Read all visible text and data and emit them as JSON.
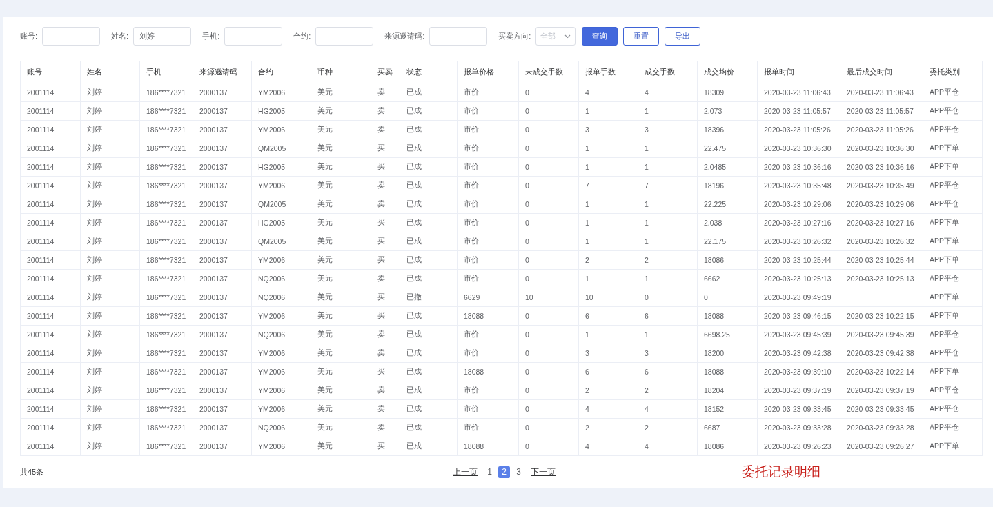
{
  "filters": [
    {
      "label": "账号:"
    },
    {
      "label": "姓名:",
      "value": "刘婷"
    },
    {
      "label": "手机:"
    },
    {
      "label": "合约:"
    },
    {
      "label": "来源邀请码:"
    }
  ],
  "direction": {
    "label": "买卖方向:",
    "placeholder": "全部"
  },
  "buttons": [
    {
      "label": "查询",
      "kind": "primary"
    },
    {
      "label": "重置",
      "kind": "outline"
    },
    {
      "label": "导出",
      "kind": "outline"
    }
  ],
  "table": {
    "columns": [
      "账号",
      "姓名",
      "手机",
      "来源邀请码",
      "合约",
      "币种",
      "买卖",
      "状态",
      "报单价格",
      "未成交手数",
      "报单手数",
      "成交手数",
      "成交均价",
      "报单时间",
      "最后成交时间",
      "委托类别"
    ],
    "rows": [
      [
        "2001114",
        "刘婷",
        "186****7321",
        "2000137",
        "YM2006",
        "美元",
        "卖",
        "已成",
        "市价",
        "0",
        "4",
        "4",
        "18309",
        "2020-03-23 11:06:43",
        "2020-03-23 11:06:43",
        "APP平仓"
      ],
      [
        "2001114",
        "刘婷",
        "186****7321",
        "2000137",
        "HG2005",
        "美元",
        "卖",
        "已成",
        "市价",
        "0",
        "1",
        "1",
        "2.073",
        "2020-03-23 11:05:57",
        "2020-03-23 11:05:57",
        "APP平仓"
      ],
      [
        "2001114",
        "刘婷",
        "186****7321",
        "2000137",
        "YM2006",
        "美元",
        "卖",
        "已成",
        "市价",
        "0",
        "3",
        "3",
        "18396",
        "2020-03-23 11:05:26",
        "2020-03-23 11:05:26",
        "APP平仓"
      ],
      [
        "2001114",
        "刘婷",
        "186****7321",
        "2000137",
        "QM2005",
        "美元",
        "买",
        "已成",
        "市价",
        "0",
        "1",
        "1",
        "22.475",
        "2020-03-23 10:36:30",
        "2020-03-23 10:36:30",
        "APP下单"
      ],
      [
        "2001114",
        "刘婷",
        "186****7321",
        "2000137",
        "HG2005",
        "美元",
        "买",
        "已成",
        "市价",
        "0",
        "1",
        "1",
        "2.0485",
        "2020-03-23 10:36:16",
        "2020-03-23 10:36:16",
        "APP下单"
      ],
      [
        "2001114",
        "刘婷",
        "186****7321",
        "2000137",
        "YM2006",
        "美元",
        "卖",
        "已成",
        "市价",
        "0",
        "7",
        "7",
        "18196",
        "2020-03-23 10:35:48",
        "2020-03-23 10:35:49",
        "APP平仓"
      ],
      [
        "2001114",
        "刘婷",
        "186****7321",
        "2000137",
        "QM2005",
        "美元",
        "卖",
        "已成",
        "市价",
        "0",
        "1",
        "1",
        "22.225",
        "2020-03-23 10:29:06",
        "2020-03-23 10:29:06",
        "APP平仓"
      ],
      [
        "2001114",
        "刘婷",
        "186****7321",
        "2000137",
        "HG2005",
        "美元",
        "买",
        "已成",
        "市价",
        "0",
        "1",
        "1",
        "2.038",
        "2020-03-23 10:27:16",
        "2020-03-23 10:27:16",
        "APP下单"
      ],
      [
        "2001114",
        "刘婷",
        "186****7321",
        "2000137",
        "QM2005",
        "美元",
        "买",
        "已成",
        "市价",
        "0",
        "1",
        "1",
        "22.175",
        "2020-03-23 10:26:32",
        "2020-03-23 10:26:32",
        "APP下单"
      ],
      [
        "2001114",
        "刘婷",
        "186****7321",
        "2000137",
        "YM2006",
        "美元",
        "买",
        "已成",
        "市价",
        "0",
        "2",
        "2",
        "18086",
        "2020-03-23 10:25:44",
        "2020-03-23 10:25:44",
        "APP下单"
      ],
      [
        "2001114",
        "刘婷",
        "186****7321",
        "2000137",
        "NQ2006",
        "美元",
        "卖",
        "已成",
        "市价",
        "0",
        "1",
        "1",
        "6662",
        "2020-03-23 10:25:13",
        "2020-03-23 10:25:13",
        "APP平仓"
      ],
      [
        "2001114",
        "刘婷",
        "186****7321",
        "2000137",
        "NQ2006",
        "美元",
        "买",
        "已撤",
        "6629",
        "10",
        "10",
        "0",
        "0",
        "2020-03-23 09:49:19",
        null,
        "APP下单"
      ],
      [
        "2001114",
        "刘婷",
        "186****7321",
        "2000137",
        "YM2006",
        "美元",
        "买",
        "已成",
        "18088",
        "0",
        "6",
        "6",
        "18088",
        "2020-03-23 09:46:15",
        "2020-03-23 10:22:15",
        "APP下单"
      ],
      [
        "2001114",
        "刘婷",
        "186****7321",
        "2000137",
        "NQ2006",
        "美元",
        "卖",
        "已成",
        "市价",
        "0",
        "1",
        "1",
        "6698.25",
        "2020-03-23 09:45:39",
        "2020-03-23 09:45:39",
        "APP平仓"
      ],
      [
        "2001114",
        "刘婷",
        "186****7321",
        "2000137",
        "YM2006",
        "美元",
        "卖",
        "已成",
        "市价",
        "0",
        "3",
        "3",
        "18200",
        "2020-03-23 09:42:38",
        "2020-03-23 09:42:38",
        "APP平仓"
      ],
      [
        "2001114",
        "刘婷",
        "186****7321",
        "2000137",
        "YM2006",
        "美元",
        "买",
        "已成",
        "18088",
        "0",
        "6",
        "6",
        "18088",
        "2020-03-23 09:39:10",
        "2020-03-23 10:22:14",
        "APP下单"
      ],
      [
        "2001114",
        "刘婷",
        "186****7321",
        "2000137",
        "YM2006",
        "美元",
        "卖",
        "已成",
        "市价",
        "0",
        "2",
        "2",
        "18204",
        "2020-03-23 09:37:19",
        "2020-03-23 09:37:19",
        "APP平仓"
      ],
      [
        "2001114",
        "刘婷",
        "186****7321",
        "2000137",
        "YM2006",
        "美元",
        "卖",
        "已成",
        "市价",
        "0",
        "4",
        "4",
        "18152",
        "2020-03-23 09:33:45",
        "2020-03-23 09:33:45",
        "APP平仓"
      ],
      [
        "2001114",
        "刘婷",
        "186****7321",
        "2000137",
        "NQ2006",
        "美元",
        "卖",
        "已成",
        "市价",
        "0",
        "2",
        "2",
        "6687",
        "2020-03-23 09:33:28",
        "2020-03-23 09:33:28",
        "APP平仓"
      ],
      [
        "2001114",
        "刘婷",
        "186****7321",
        "2000137",
        "YM2006",
        "美元",
        "买",
        "已成",
        "18088",
        "0",
        "4",
        "4",
        "18086",
        "2020-03-23 09:26:23",
        "2020-03-23 09:26:27",
        "APP下单"
      ]
    ]
  },
  "total": "共45条",
  "pagination": {
    "prev": "上一页",
    "next": "下一页",
    "pages": [
      {
        "label": "1",
        "selected": false
      },
      {
        "label": "2",
        "selected": true
      },
      {
        "label": "3",
        "selected": false
      }
    ]
  },
  "caption": "委托记录明细"
}
